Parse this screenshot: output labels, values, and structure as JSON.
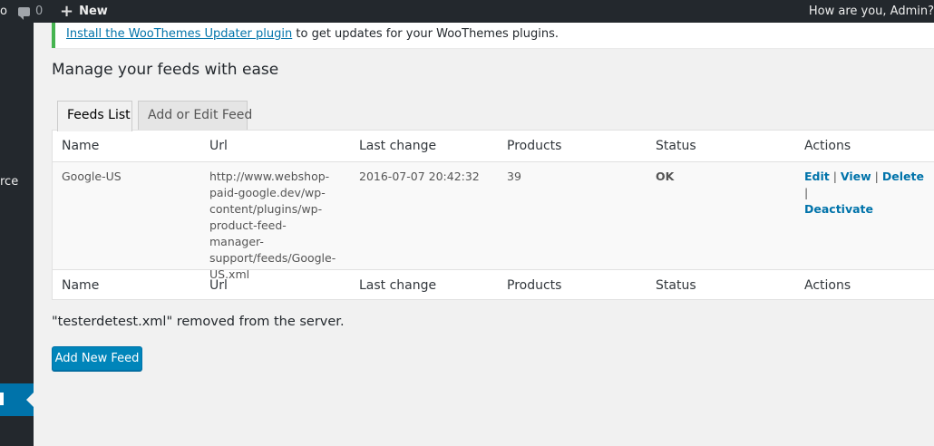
{
  "admin_bar": {
    "clip_text": "o",
    "comments_count": "0",
    "new_label": "New",
    "howdy": "How are you, Admin?"
  },
  "sidebar": {
    "fragment_label": "rce"
  },
  "notice": {
    "link_text": "Install the WooThemes Updater plugin",
    "rest_text": " to get updates for your WooThemes plugins."
  },
  "page_title": "Manage your feeds with ease",
  "tabs": [
    {
      "label": "Feeds List",
      "active": true
    },
    {
      "label": "Add or Edit Feed",
      "active": false
    }
  ],
  "table": {
    "columns": [
      "Name",
      "Url",
      "Last change",
      "Products",
      "Status",
      "Actions"
    ],
    "rows": [
      {
        "name": "Google-US",
        "url": "http://www.webshop-paid-google.dev/wp-content/plugins/wp-product-feed-manager-support/feeds/Google-US.xml",
        "last_change": "2016-07-07 20:42:32",
        "products": "39",
        "status": "OK",
        "actions": [
          "Edit",
          "View",
          "Delete",
          "Deactivate"
        ]
      }
    ]
  },
  "message": "\"testerdetest.xml\" removed from the server.",
  "add_button_label": "Add New Feed",
  "colors": {
    "admin_bar": "#23282d",
    "accent": "#0073aa",
    "button": "#0085ba",
    "status_ok": "#7ad03a",
    "notice_border": "#46b450"
  }
}
